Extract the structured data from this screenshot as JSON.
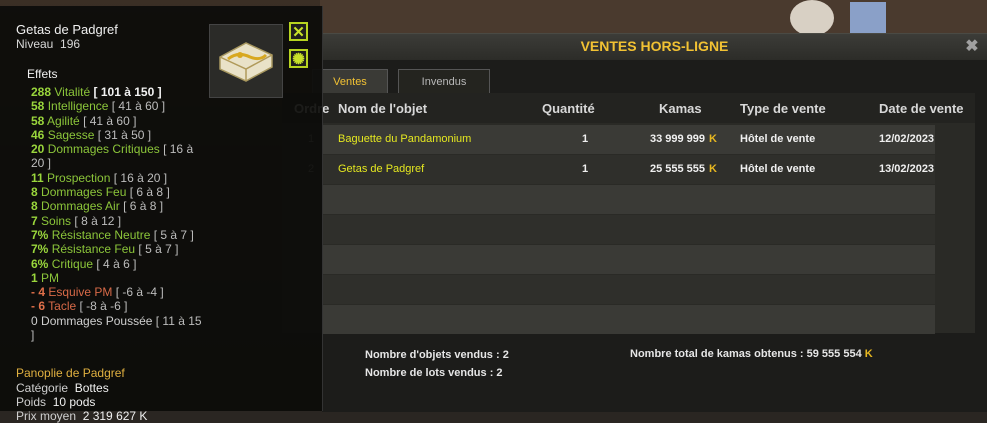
{
  "tooltip": {
    "item_name": "Getas de Padgref",
    "level_label": "Niveau",
    "level_value": "196",
    "effects_title": "Effets",
    "effects": [
      {
        "value": "288",
        "name": "Vitalité",
        "range": "[ 101 à 150 ]",
        "kind": "pos",
        "bold_range": true
      },
      {
        "value": "58",
        "name": "Intelligence",
        "range": "[ 41 à 60 ]",
        "kind": "pos"
      },
      {
        "value": "58",
        "name": "Agilité",
        "range": "[ 41 à 60 ]",
        "kind": "pos"
      },
      {
        "value": "46",
        "name": "Sagesse",
        "range": "[ 31 à 50 ]",
        "kind": "pos"
      },
      {
        "value": "20",
        "name": "Dommages Critiques",
        "range": "[ 16 à",
        "kind": "pos"
      },
      {
        "value": "",
        "name": "",
        "range": "20 ]",
        "kind": "pos"
      },
      {
        "value": "11",
        "name": "Prospection",
        "range": "[ 16 à 20 ]",
        "kind": "pos"
      },
      {
        "value": "8",
        "name": "Dommages Feu",
        "range": "[ 6 à 8 ]",
        "kind": "pos"
      },
      {
        "value": "8",
        "name": "Dommages Air",
        "range": "[ 6 à 8 ]",
        "kind": "pos"
      },
      {
        "value": "7",
        "name": "Soins",
        "range": "[ 8 à 12 ]",
        "kind": "pos"
      },
      {
        "value": "7%",
        "name": "Résistance Neutre",
        "range": "[ 5 à 7 ]",
        "kind": "pos"
      },
      {
        "value": "7%",
        "name": "Résistance Feu",
        "range": "[ 5 à 7 ]",
        "kind": "pos"
      },
      {
        "value": "6%",
        "name": "Critique",
        "range": "[ 4 à 6 ]",
        "kind": "pos"
      },
      {
        "value": "1",
        "name": "PM",
        "range": "",
        "kind": "pos"
      },
      {
        "value": "- 4",
        "name": "Esquive PM",
        "range": "[ -6 à -4 ]",
        "kind": "neg"
      },
      {
        "value": "- 6",
        "name": "Tacle",
        "range": "[ -8 à -6 ]",
        "kind": "neg"
      },
      {
        "value": "0",
        "name": "Dommages Poussée",
        "range": "[ 11 à 15",
        "kind": "neu"
      },
      {
        "value": "",
        "name": "",
        "range": "]",
        "kind": "neu"
      }
    ],
    "set_name": "Panoplie de Padgref",
    "category_label": "Catégorie",
    "category_value": "Bottes",
    "weight_label": "Poids",
    "weight_value": "10 pods",
    "avg_price_label": "Prix moyen",
    "avg_price_value": "2 319 627 K",
    "close_icon": "close-icon",
    "settings_icon": "gear-icon"
  },
  "window": {
    "title": "VENTES HORS-LIGNE",
    "close_glyph": "✖",
    "tabs": [
      {
        "label": "Ventes",
        "active": true
      },
      {
        "label": "Invendus",
        "active": false
      }
    ],
    "columns": {
      "order": "Ordre",
      "name": "Nom de l'objet",
      "quantity": "Quantité",
      "kamas": "Kamas",
      "sale_type": "Type de vente",
      "sale_date": "Date de vente"
    },
    "rows": [
      {
        "order": "1",
        "name": "Baguette du Pandamonium",
        "quantity": "1",
        "kamas": "33 999 999",
        "sale_type": "Hôtel de vente",
        "sale_date": "12/02/2023"
      },
      {
        "order": "2",
        "name": "Getas de Padgref",
        "quantity": "1",
        "kamas": "25 555 555",
        "sale_type": "Hôtel de vente",
        "sale_date": "13/02/2023"
      }
    ],
    "footer": {
      "objects_sold": "Nombre d'objets vendus : 2",
      "lots_sold": "Nombre de lots vendus : 2",
      "total_kamas": "Nombre total de kamas obtenus : 59 555 554"
    },
    "kama_symbol": "K"
  },
  "colors": {
    "accent_yellow": "#f2c233",
    "item_name_yellow": "#e5e820",
    "positive_green": "#8cc63a",
    "negative_red": "#d86a48",
    "button_green": "#b7d420"
  }
}
